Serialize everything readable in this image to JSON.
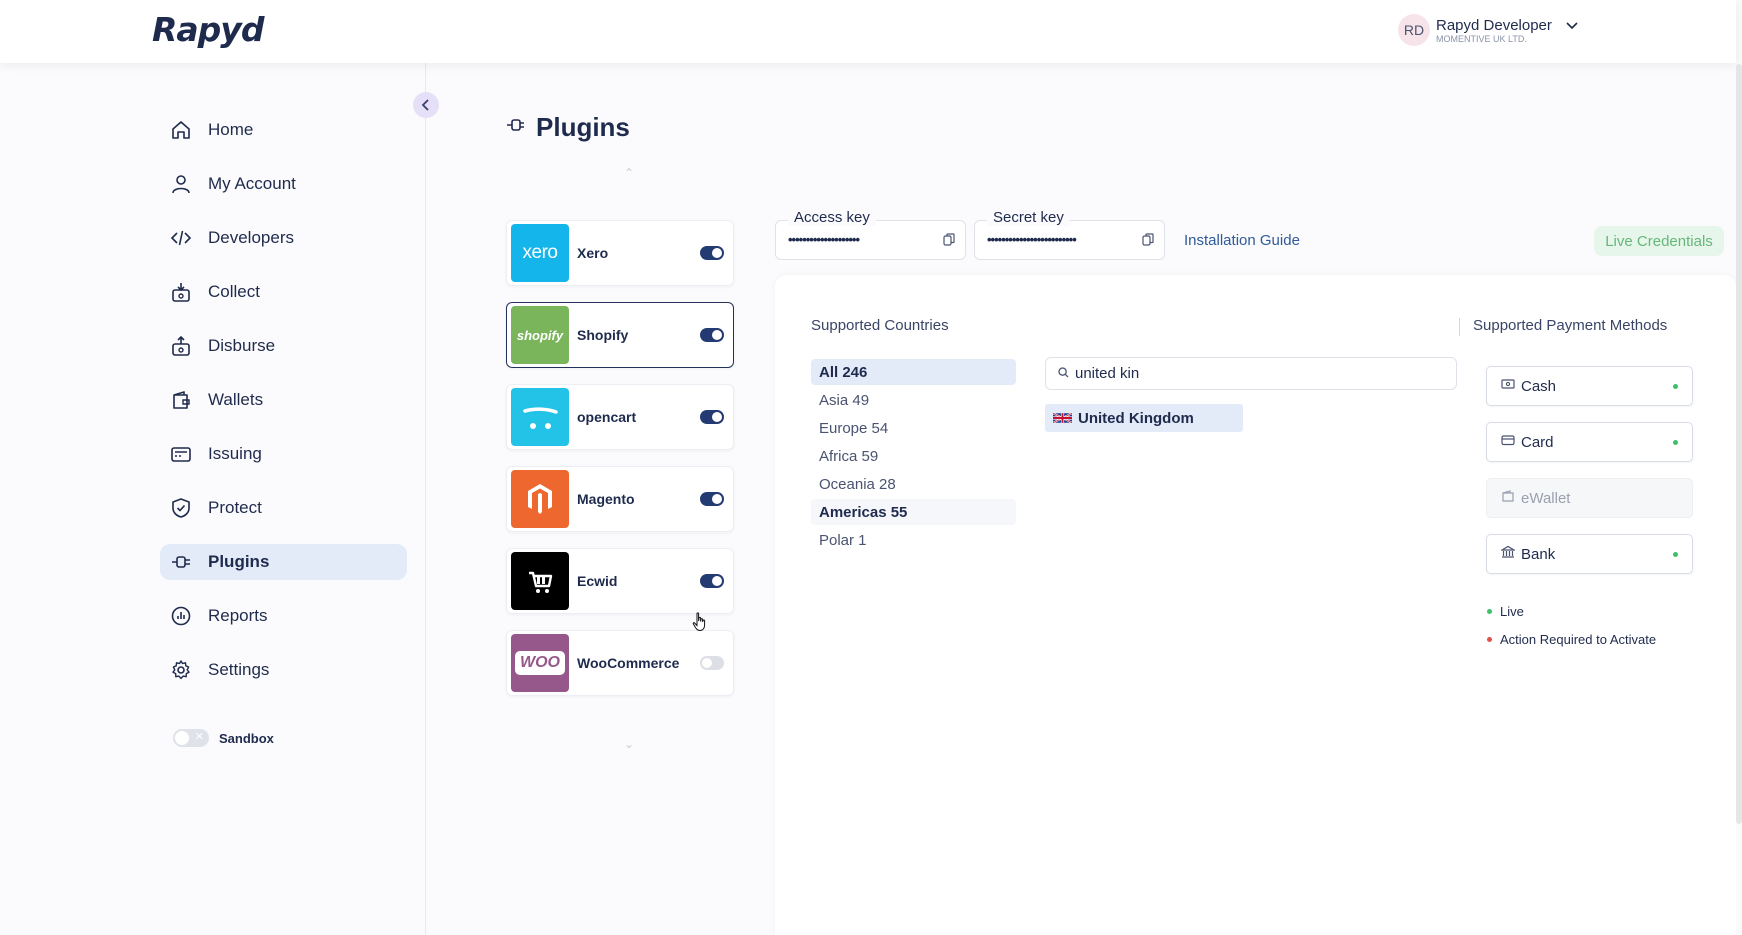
{
  "header": {
    "logo": "Rapyd",
    "user_initials": "RD",
    "user_name": "Rapyd Developer",
    "user_company": "MOMENTIVE UK LTD."
  },
  "sidebar": {
    "items": [
      {
        "label": "Home",
        "icon": "home-icon"
      },
      {
        "label": "My Account",
        "icon": "user-icon"
      },
      {
        "label": "Developers",
        "icon": "code-icon"
      },
      {
        "label": "Collect",
        "icon": "collect-icon"
      },
      {
        "label": "Disburse",
        "icon": "disburse-icon"
      },
      {
        "label": "Wallets",
        "icon": "wallet-icon"
      },
      {
        "label": "Issuing",
        "icon": "card-icon"
      },
      {
        "label": "Protect",
        "icon": "shield-icon"
      },
      {
        "label": "Plugins",
        "icon": "plug-icon",
        "active": true
      },
      {
        "label": "Reports",
        "icon": "reports-icon"
      },
      {
        "label": "Settings",
        "icon": "gear-icon"
      }
    ],
    "sandbox_label": "Sandbox",
    "sandbox_on": false
  },
  "page": {
    "title": "Plugins"
  },
  "plugins": [
    {
      "name": "Xero",
      "logo_text": "xero",
      "color": "#13b5ea",
      "enabled": true
    },
    {
      "name": "Shopify",
      "logo_text": "shopify",
      "color": "#7ab55c",
      "enabled": true,
      "selected": true
    },
    {
      "name": "opencart",
      "logo_text": "",
      "color": "#23c3e8",
      "enabled": true
    },
    {
      "name": "Magento",
      "logo_text": "",
      "color": "#ee672f",
      "enabled": true
    },
    {
      "name": "Ecwid",
      "logo_text": "",
      "color": "#000000",
      "enabled": true
    },
    {
      "name": "WooCommerce",
      "logo_text": "WOO",
      "color": "#96588a",
      "enabled": false
    }
  ],
  "credentials": {
    "access_key_label": "Access key",
    "access_key_value": "••••••••••••••••••••",
    "secret_key_label": "Secret key",
    "secret_key_value": "•••••••••••••••••••••••••",
    "install_guide": "Installation Guide",
    "live_credentials": "Live Credentials"
  },
  "countries": {
    "title": "Supported Countries",
    "regions": [
      {
        "label": "All 246",
        "state": "active"
      },
      {
        "label": "Asia 49",
        "state": ""
      },
      {
        "label": "Europe 54",
        "state": ""
      },
      {
        "label": "Africa 59",
        "state": ""
      },
      {
        "label": "Oceania 28",
        "state": ""
      },
      {
        "label": "Americas 55",
        "state": "hover"
      },
      {
        "label": "Polar 1",
        "state": ""
      }
    ],
    "search_value": "united kin",
    "results": [
      "United Kingdom"
    ]
  },
  "payment_methods": {
    "title": "Supported Payment Methods",
    "items": [
      {
        "label": "Cash",
        "icon": "cash-icon",
        "active": true
      },
      {
        "label": "Card",
        "icon": "card-icon",
        "active": true
      },
      {
        "label": "eWallet",
        "icon": "ewallet-icon",
        "active": false
      },
      {
        "label": "Bank",
        "icon": "bank-icon",
        "active": true
      }
    ],
    "legend": [
      {
        "label": "Live",
        "color": "#3fbf6b"
      },
      {
        "label": "Action Required to Activate",
        "color": "#e0514a"
      }
    ]
  }
}
